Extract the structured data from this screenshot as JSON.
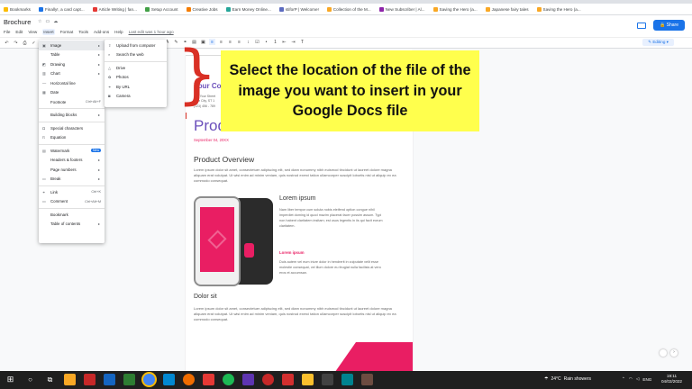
{
  "bookmarks": [
    "Bookmarks",
    "Finally!, a card capt...",
    "Article Writing | fan...",
    "Setup Account",
    "Creative Jobs",
    "Earn Money Online...",
    "stiforP | Welcome!",
    "Collection of the M...",
    "New Subscriber | Al...",
    "Saving the Hero (a...",
    "Japanese fairy tales",
    "Saving the Hero (a..."
  ],
  "doc": {
    "title": "Brochure"
  },
  "menubar": {
    "items": [
      "File",
      "Edit",
      "View",
      "Insert",
      "Format",
      "Tools",
      "Add-ons",
      "Help"
    ],
    "last_edit": "Last edit was 1 hour ago"
  },
  "share_label": "Share",
  "editing_label": "Editing",
  "insert_menu": {
    "image": "Image",
    "table": "Table",
    "drawing": "Drawing",
    "chart": "Chart",
    "horizontal_line": "Horizontal line",
    "date": "Date",
    "footnote": "Footnote",
    "footnote_shortcut": "Ctrl+Alt+F",
    "building_blocks": "Building blocks",
    "special_characters": "Special characters",
    "equation": "Equation",
    "watermark": "Watermark",
    "new_badge": "New",
    "headers_footers": "Headers & footers",
    "page_numbers": "Page numbers",
    "break": "Break",
    "link": "Link",
    "link_shortcut": "Ctrl+K",
    "comment": "Comment",
    "comment_shortcut": "Ctrl+Alt+M",
    "bookmark": "Bookmark",
    "table_of_contents": "Table of contents"
  },
  "image_submenu": {
    "upload": "Upload from computer",
    "search": "Search the web",
    "drive": "Drive",
    "photos": "Photos",
    "by_url": "By URL",
    "camera": "Camera"
  },
  "callout": "Select the location of the file of the image you want to insert in your Google Docs file",
  "page": {
    "company": "Your Co",
    "address": [
      "123 Your Street",
      "Your City, ST 1",
      "(123) 456 - 789"
    ],
    "heading": "Prod",
    "date": "September 04, 20XX",
    "overview_title": "Product Overview",
    "overview_text": "Lorem ipsum dolor sit amet, consectetuer adipiscing elit, sed diam nonummy nibh euismod tincidunt ut laoreet dolore magna aliquam erat volutpat. Ut wisi enim ad minim veniam, quis nostrud exerci tation ullamcorper suscipit lobortis nisl ut aliquip ex ea commodo consequat.",
    "lorem_title": "Lorem ipsum",
    "lorem_text": "Nam liber tempor cum soluta nobis eleifend option congue nihil imperdiet doming id quod mazim placerat facer possim assum. Typi non habent claritatem insitam; est usus legentis in iis qui facit eorum claritatem.",
    "lorem_sub": "Lorem ipsum",
    "lorem_sub_text": "Duis autem vel eum iriure dolor in hendrerit in vulputate velit esse molestie consequat, vel illum dolore eu feugiat nulla facilisis at vero eros et accumsan.",
    "dolor_title": "Dolor sit",
    "dolor_text": "Lorem ipsum dolor sit amet, consectetuer adipiscing elit, sed diam nonummy nibh euismod tincidunt ut laoreet dolore magna aliquam erat volutpat. Ut wisi enim ad minim veniam, quis nostrud exerci tation ullamcorper suscipit lobortis nisl ut aliquip ex ea commodo consequat."
  },
  "taskbar": {
    "weather_temp": "24°C",
    "weather_text": "Rain showers",
    "lang": "ENG",
    "time": "19:11",
    "date": "04/02/2022"
  },
  "colors": {
    "accent": "#1a73e8",
    "callout_bg": "#ffff4d",
    "bracket": "#d93025",
    "brand_purple": "#6b4fbb",
    "brand_pink": "#e91e63"
  }
}
